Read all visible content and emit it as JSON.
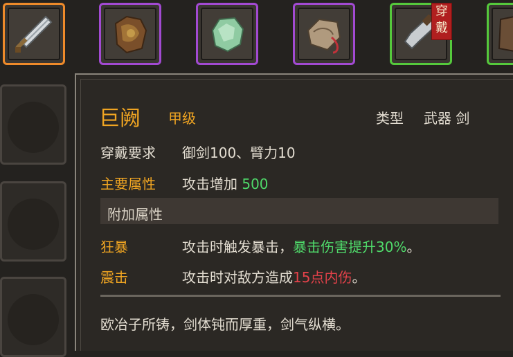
{
  "slots": [
    {
      "icon": "sword-icon",
      "border": "#ee8a2a"
    },
    {
      "icon": "leather-armor-icon",
      "border": "#a24ad2"
    },
    {
      "icon": "jade-gem-icon",
      "border": "#a24ad2"
    },
    {
      "icon": "scroll-pouch-icon",
      "border": "#a24ad2"
    },
    {
      "icon": "broad-sword-icon",
      "border": "#55c93c",
      "badge": "穿戴"
    },
    {
      "icon": "armor-icon",
      "border": "#55c93c"
    }
  ],
  "item": {
    "name": "巨阙",
    "grade": "甲级",
    "type_label": "类型",
    "type_value": "武器 剑",
    "requirement_label": "穿戴要求",
    "requirement_value": "御剑100、臂力10",
    "main_attr_label": "主要属性",
    "main_attr_text": "攻击增加",
    "main_attr_value": "500",
    "extra_section": "附加属性",
    "extras": [
      {
        "name": "狂暴",
        "text": "攻击时触发暴击，",
        "highlight": "暴击伤害提升30%",
        "end": "。"
      },
      {
        "name": "震击",
        "text": "攻击时对敌方造成",
        "highlight": "15点内伤",
        "end": "。"
      }
    ],
    "description": "欧冶子所铸，剑体钝而厚重，剑气纵横。"
  }
}
